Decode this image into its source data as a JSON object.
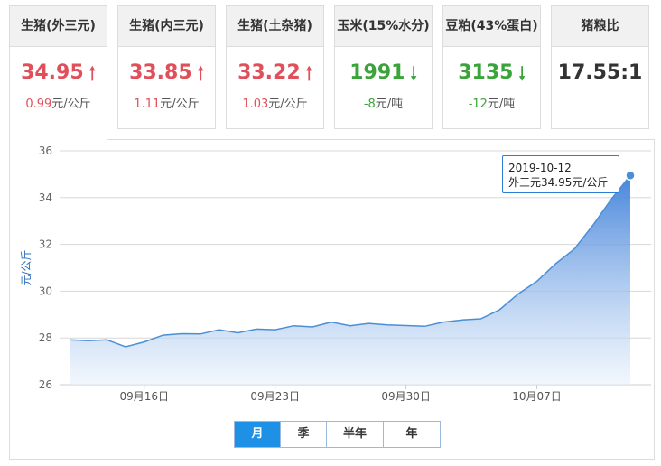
{
  "cards": [
    {
      "title": "生猪(外三元)",
      "value": "34.95",
      "arrow": "up",
      "change": "0.99",
      "unit": "元/公斤"
    },
    {
      "title": "生猪(内三元)",
      "value": "33.85",
      "arrow": "up",
      "change": "1.11",
      "unit": "元/公斤"
    },
    {
      "title": "生猪(土杂猪)",
      "value": "33.22",
      "arrow": "up",
      "change": "1.03",
      "unit": "元/公斤"
    },
    {
      "title": "玉米(15%水分)",
      "value": "1991",
      "arrow": "down",
      "change": "-8",
      "unit": "元/吨"
    },
    {
      "title": "豆粕(43%蛋白)",
      "value": "3135",
      "arrow": "down",
      "change": "-12",
      "unit": "元/吨"
    },
    {
      "title": "猪粮比",
      "value": "17.55:1",
      "arrow": "none",
      "change": "",
      "unit": ""
    }
  ],
  "colors": {
    "up": "#e0505a",
    "down": "#3aa43a",
    "accent": "#1e90e6",
    "line": "#4a8fd6"
  },
  "tooltip": {
    "date": "2019-10-12",
    "text": "外三元34.95元/公斤"
  },
  "periods": [
    "月",
    "季",
    "半年",
    "年"
  ],
  "active_period": "月",
  "chart_data": {
    "type": "area",
    "ylabel": "元/公斤",
    "ylim": [
      26,
      36
    ],
    "yticks": [
      26,
      28,
      30,
      32,
      34,
      36
    ],
    "xtick_labels": [
      "09月16日",
      "09月23日",
      "09月30日",
      "10月07日"
    ],
    "x": [
      "2019-09-12",
      "2019-09-13",
      "2019-09-14",
      "2019-09-15",
      "2019-09-16",
      "2019-09-17",
      "2019-09-18",
      "2019-09-19",
      "2019-09-20",
      "2019-09-21",
      "2019-09-22",
      "2019-09-23",
      "2019-09-24",
      "2019-09-25",
      "2019-09-26",
      "2019-09-27",
      "2019-09-28",
      "2019-09-29",
      "2019-09-30",
      "2019-10-01",
      "2019-10-02",
      "2019-10-03",
      "2019-10-04",
      "2019-10-05",
      "2019-10-06",
      "2019-10-07",
      "2019-10-08",
      "2019-10-09",
      "2019-10-10",
      "2019-10-11",
      "2019-10-12"
    ],
    "series": [
      {
        "name": "外三元",
        "values": [
          27.92,
          27.88,
          27.92,
          27.62,
          27.83,
          28.12,
          28.18,
          28.17,
          28.35,
          28.22,
          28.38,
          28.35,
          28.52,
          28.47,
          28.68,
          28.52,
          28.62,
          28.56,
          28.53,
          28.5,
          28.68,
          28.77,
          28.82,
          29.2,
          29.88,
          30.42,
          31.17,
          31.8,
          32.82,
          33.95,
          34.95
        ]
      }
    ],
    "grid": true,
    "legend": "none"
  }
}
